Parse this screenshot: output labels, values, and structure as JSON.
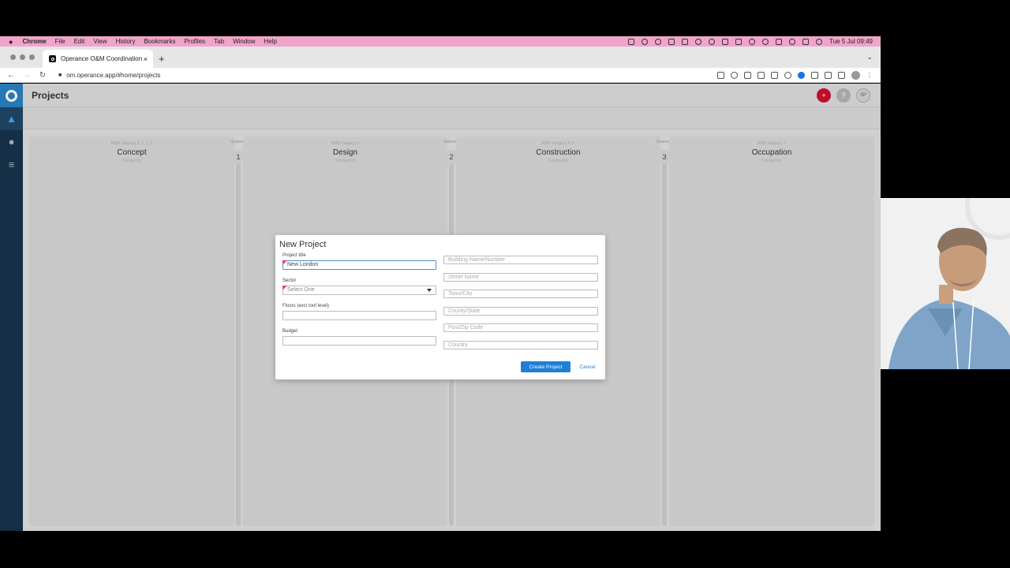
{
  "menubar": {
    "app": "Chrome",
    "items": [
      "File",
      "Edit",
      "View",
      "History",
      "Bookmarks",
      "Profiles",
      "Tab",
      "Window",
      "Help"
    ],
    "clock": "Tue 5 Jul  09:49"
  },
  "browser": {
    "tab_title": "Operance O&M Coordination",
    "tab_close": "×",
    "new_tab": "+",
    "tab_menu": "⌄",
    "url": "om.operance.app/#home/projects"
  },
  "app": {
    "page_title": "Projects",
    "add_label": "+",
    "help_label": "?",
    "user_initials": "SP",
    "columns": [
      {
        "stage": "RIBA Stage(s) 0, 1, 2, 3",
        "name": "Concept",
        "count": "0 project(s)"
      },
      {
        "stage": "RIBA Stage(s) 4",
        "name": "Design",
        "count": "0 project(s)"
      },
      {
        "stage": "RIBA Stage(s) 5, 6",
        "name": "Construction",
        "count": "0 project(s)"
      },
      {
        "stage": "RIBA Stage(s) 7",
        "name": "Occupation",
        "count": "0 project(s)"
      }
    ],
    "gateways": [
      {
        "label": "Gateway",
        "number": "1"
      },
      {
        "label": "Gateway",
        "number": "2"
      },
      {
        "label": "Gateway",
        "number": "3"
      }
    ]
  },
  "modal": {
    "title": "New Project",
    "project_title_label": "Project title",
    "project_title_value": "New London",
    "sector_label": "Sector",
    "sector_value": "Select One",
    "floors_label": "Floors (excl roof level)",
    "floors_value": "",
    "budget_label": "Budget",
    "budget_value": "",
    "address_placeholders": {
      "building": "Building Name/Number",
      "street": "Street Name",
      "town": "Town/City",
      "county": "County/State",
      "postcode": "Post/Zip Code",
      "country": "Country"
    },
    "create_label": "Create Project",
    "cancel_label": "Cancel"
  },
  "colors": {
    "menubar": "#f0a4c8",
    "sidebar": "#16324a",
    "accent": "#1f7fd6",
    "add_button": "#c8102e"
  }
}
